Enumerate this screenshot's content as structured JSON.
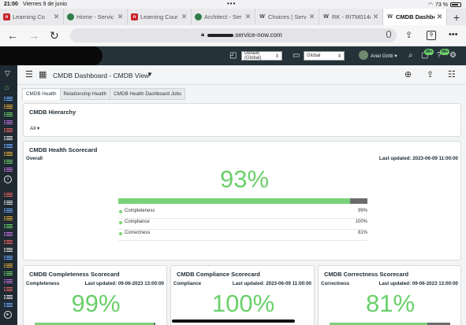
{
  "status_bar": {
    "time": "21:00",
    "date": "Viernes 9 de junio",
    "battery": "73 %"
  },
  "tabs": [
    {
      "label": "Learning Co",
      "favicon": "red"
    },
    {
      "label": "Home - Servic",
      "favicon": "green"
    },
    {
      "label": "Learning Cour",
      "favicon": "red"
    },
    {
      "label": "Architect - Ser",
      "favicon": "green"
    },
    {
      "label": "Choices | Serv",
      "favicon": "w"
    },
    {
      "label": "RK - RITM014(",
      "favicon": "w"
    },
    {
      "label": "CMDB Dashbo",
      "favicon": "w",
      "active": true
    }
  ],
  "address": {
    "url_suffix": ".service-now.com",
    "tab_count": "9"
  },
  "sn_header": {
    "domain_select": "Default (Global)",
    "app_select": "Global",
    "user_name": "Ariel Gritti",
    "badge_a": "99+",
    "badge_b": "99+"
  },
  "dashboard": {
    "title": "CMDB Dashboard - CMDB View",
    "tabs": [
      "CMDB Health",
      "Relationship Health",
      "CMDB Health Dashboard Jobs"
    ]
  },
  "hierarchy": {
    "title": "CMDB Hierarchy",
    "filter_value": "All"
  },
  "scorecard": {
    "title": "CMDB Health Scorecard",
    "subtitle": "Overall",
    "updated": "Last updated: 2023-06-09 11:00:00",
    "percent": "93%",
    "fill": 0.93,
    "rows": [
      {
        "name": "Completeness",
        "value": "99%"
      },
      {
        "name": "Compliance",
        "value": "100%"
      },
      {
        "name": "Correctness",
        "value": "81%"
      }
    ]
  },
  "sub_cards": [
    {
      "title": "CMDB Completeness Scorecard",
      "subtitle": "Completeness",
      "updated": "Last updated: 09-06-2023 13:00:00",
      "percent": "99%",
      "fill": 0.99
    },
    {
      "title": "CMDB Compliance Scorecard",
      "subtitle": "Compliance",
      "updated": "Last updated: 2023-06-09 11:00:00",
      "percent": "100%",
      "fill": 1.0
    },
    {
      "title": "CMDB Correctness Scorecard",
      "subtitle": "Correctness",
      "updated": "Last updated: 09-06-2023 13:00:00",
      "percent": "81%",
      "fill": 0.81
    }
  ],
  "colors": {
    "accent_green": "#6ad06a",
    "header_dark": "#26323a",
    "nav_dark": "#1f2a32"
  }
}
